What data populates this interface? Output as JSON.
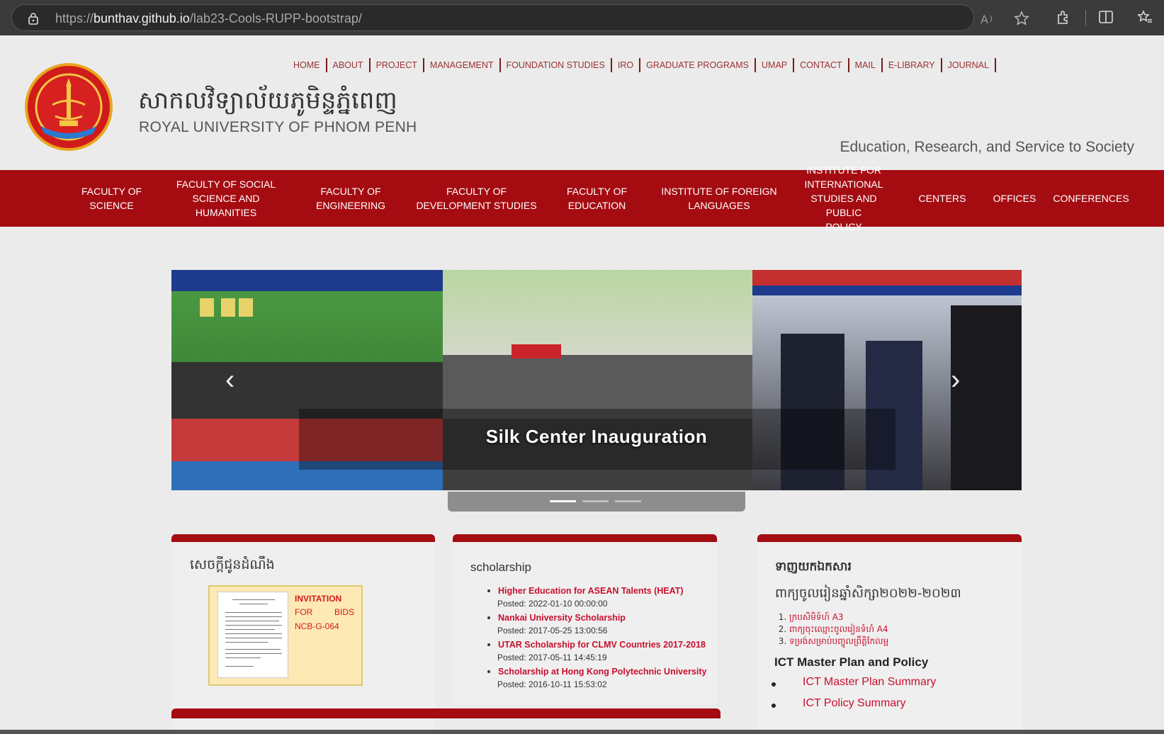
{
  "browser": {
    "url_prefix": "https://",
    "url_host": "bunthav.github.io",
    "url_path": "/lab23-Cools-RUPP-bootstrap/"
  },
  "topnav": [
    "HOME",
    "ABOUT",
    "PROJECT",
    "MANAGEMENT",
    "FOUNDATION STUDIES",
    "IRO",
    "GRADUATE PROGRAMS",
    "UMAP",
    "CONTACT",
    "MAIL",
    "E-LIBRARY",
    "JOURNAL"
  ],
  "header": {
    "khmer_name": "សាកលវិទ្យាល័យភូមិន្ទភ្នំពេញ",
    "english_name": "ROYAL UNIVERSITY OF PHNOM PENH",
    "tagline": "Education, Research, and Service to Society"
  },
  "mainnav": [
    "FACULTY OF\nSCIENCE",
    "FACULTY OF SOCIAL\nSCIENCE AND\nHUMANITIES",
    "FACULTY OF\nENGINEERING",
    "FACULTY OF\nDEVELOPMENT STUDIES",
    "FACULTY OF\nEDUCATION",
    "INSTITUTE OF FOREIGN\nLANGUAGES",
    "INSTITUTE FOR\nINTERNATIONAL\nSTUDIES AND PUBLIC\nPOLICY",
    "CENTERS",
    "OFFICES",
    "CONFERENCES"
  ],
  "carousel": {
    "caption": "Silk Center Inauguration",
    "active_index": 0,
    "slide_count": 3
  },
  "announcement": {
    "title": "សេចក្តីជូនដំណឹង",
    "invite_line1": "INVITATION",
    "invite_line2a": "FOR",
    "invite_line2b": "BIDS",
    "invite_line3": "NCB-G-064"
  },
  "scholarship": {
    "title": "scholarship",
    "items": [
      {
        "label": "Higher Education for ASEAN Talents (HEAT)",
        "posted": "Posted: 2022-01-10 00:00:00"
      },
      {
        "label": "Nankai University Scholarship",
        "posted": "Posted: 2017-05-25 13:00:56"
      },
      {
        "label": "UTAR Scholarship for CLMV Countries 2017-2018",
        "posted": "Posted: 2017-05-11 14:45:19"
      },
      {
        "label": "Scholarship at Hong Kong Polytechnic University",
        "posted": "Posted: 2016-10-11 15:53:02"
      }
    ]
  },
  "downloads": {
    "title": "ទាញយកឯកសារ",
    "subtitle": "ពាក្យចូលរៀនឆ្នាំសិក្សា២០២២-២០២៣",
    "items": [
      "ក្របសិមិទ៍ហ៍ A3",
      "ពាក្យចុះឈ្មោះចូលរៀនទំហំ A4",
      "ទម្រង់សម្រាប់បញ្ចូលព្រឹត្តិកែលម្អ"
    ],
    "ict_title": "ICT Master Plan and Policy",
    "ict_items": [
      "ICT Master Plan Summary",
      "ICT Policy Summary"
    ]
  },
  "colors": {
    "brand_red": "#a40c12",
    "link_red": "#c8102e",
    "top_nav_text": "#9a3030"
  }
}
